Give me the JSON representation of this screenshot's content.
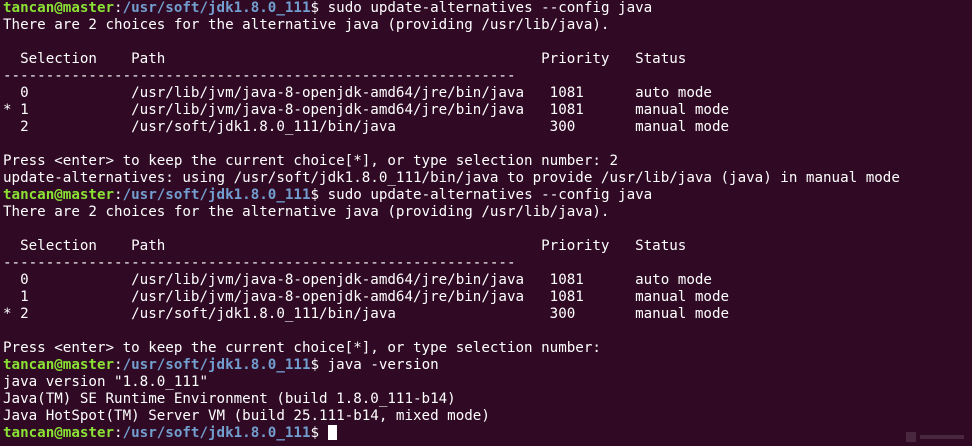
{
  "prompt": {
    "user_host": "tancan@master",
    "separator": ":",
    "cwd": "/usr/soft/jdk1.8.0_111",
    "symbol": "$ "
  },
  "colors": {
    "background": "#300a24",
    "text": "#ffffff",
    "user_host": "#8ae234",
    "cwd": "#729fcf"
  },
  "lines": [
    {
      "type": "prompt",
      "command": "sudo update-alternatives --config java"
    },
    {
      "type": "text",
      "text": "There are 2 choices for the alternative java (providing /usr/lib/java)."
    },
    {
      "type": "text",
      "text": ""
    },
    {
      "type": "text",
      "text": "  Selection    Path                                            Priority   Status"
    },
    {
      "type": "text",
      "text": "------------------------------------------------------------"
    },
    {
      "type": "text",
      "text": "  0            /usr/lib/jvm/java-8-openjdk-amd64/jre/bin/java   1081      auto mode"
    },
    {
      "type": "text",
      "text": "* 1            /usr/lib/jvm/java-8-openjdk-amd64/jre/bin/java   1081      manual mode"
    },
    {
      "type": "text",
      "text": "  2            /usr/soft/jdk1.8.0_111/bin/java                  300       manual mode"
    },
    {
      "type": "text",
      "text": ""
    },
    {
      "type": "text",
      "text": "Press <enter> to keep the current choice[*], or type selection number: 2"
    },
    {
      "type": "text",
      "text": "update-alternatives: using /usr/soft/jdk1.8.0_111/bin/java to provide /usr/lib/java (java) in manual mode"
    },
    {
      "type": "prompt",
      "command": "sudo update-alternatives --config java"
    },
    {
      "type": "text",
      "text": "There are 2 choices for the alternative java (providing /usr/lib/java)."
    },
    {
      "type": "text",
      "text": ""
    },
    {
      "type": "text",
      "text": "  Selection    Path                                            Priority   Status"
    },
    {
      "type": "text",
      "text": "------------------------------------------------------------"
    },
    {
      "type": "text",
      "text": "  0            /usr/lib/jvm/java-8-openjdk-amd64/jre/bin/java   1081      auto mode"
    },
    {
      "type": "text",
      "text": "  1            /usr/lib/jvm/java-8-openjdk-amd64/jre/bin/java   1081      manual mode"
    },
    {
      "type": "text",
      "text": "* 2            /usr/soft/jdk1.8.0_111/bin/java                  300       manual mode"
    },
    {
      "type": "text",
      "text": ""
    },
    {
      "type": "text",
      "text": "Press <enter> to keep the current choice[*], or type selection number:"
    },
    {
      "type": "prompt",
      "command": "java -version"
    },
    {
      "type": "text",
      "text": "java version \"1.8.0_111\""
    },
    {
      "type": "text",
      "text": "Java(TM) SE Runtime Environment (build 1.8.0_111-b14)"
    },
    {
      "type": "text",
      "text": "Java HotSpot(TM) Server VM (build 25.111-b14, mixed mode)"
    },
    {
      "type": "prompt",
      "command": "",
      "cursor": true
    }
  ]
}
